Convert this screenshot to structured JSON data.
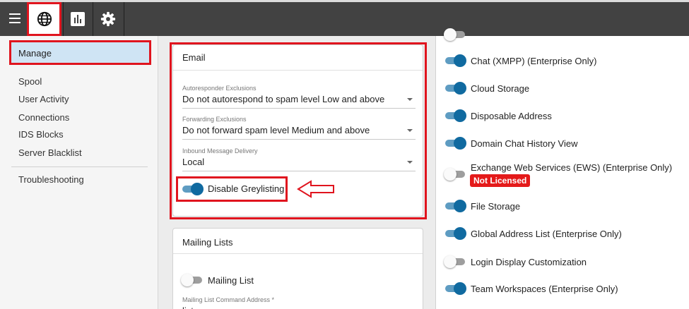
{
  "toolbar": {
    "buttons": [
      "globe-icon",
      "chart-icon",
      "gear-icon"
    ]
  },
  "sidebar": {
    "active": "Manage",
    "items": [
      "Spool",
      "User Activity",
      "Connections",
      "IDS Blocks",
      "Server Blacklist"
    ],
    "bottom_item": "Troubleshooting"
  },
  "email_card": {
    "title": "Email",
    "autoresponder": {
      "label": "Autoresponder Exclusions",
      "value": "Do not autorespond to spam level Low and above"
    },
    "forwarding": {
      "label": "Forwarding Exclusions",
      "value": "Do not forward spam level Medium and above"
    },
    "inbound": {
      "label": "Inbound Message Delivery",
      "value": "Local"
    },
    "greylisting": {
      "label": "Disable Greylisting",
      "on": true
    }
  },
  "mailing_card": {
    "title": "Mailing Lists",
    "toggle": {
      "label": "Mailing List",
      "on": false
    },
    "command_label": "Mailing List Command Address *",
    "command_value": "listserv"
  },
  "features": [
    {
      "label": "",
      "on": false
    },
    {
      "label": "Chat (XMPP) (Enterprise Only)",
      "on": true
    },
    {
      "label": "Cloud Storage",
      "on": true
    },
    {
      "label": "Disposable Address",
      "on": true
    },
    {
      "label": "Domain Chat History View",
      "on": true
    },
    {
      "label": "Exchange Web Services (EWS) (Enterprise Only)",
      "on": false,
      "badge": "Not Licensed"
    },
    {
      "label": "File Storage",
      "on": true
    },
    {
      "label": "Global Address List (Enterprise Only)",
      "on": true
    },
    {
      "label": "Login Display Customization",
      "on": false
    },
    {
      "label": "Team Workspaces (Enterprise Only)",
      "on": true
    }
  ],
  "colors": {
    "accent": "#106aa0",
    "highlight": "#e0141e",
    "badge": "#e41a1a"
  }
}
